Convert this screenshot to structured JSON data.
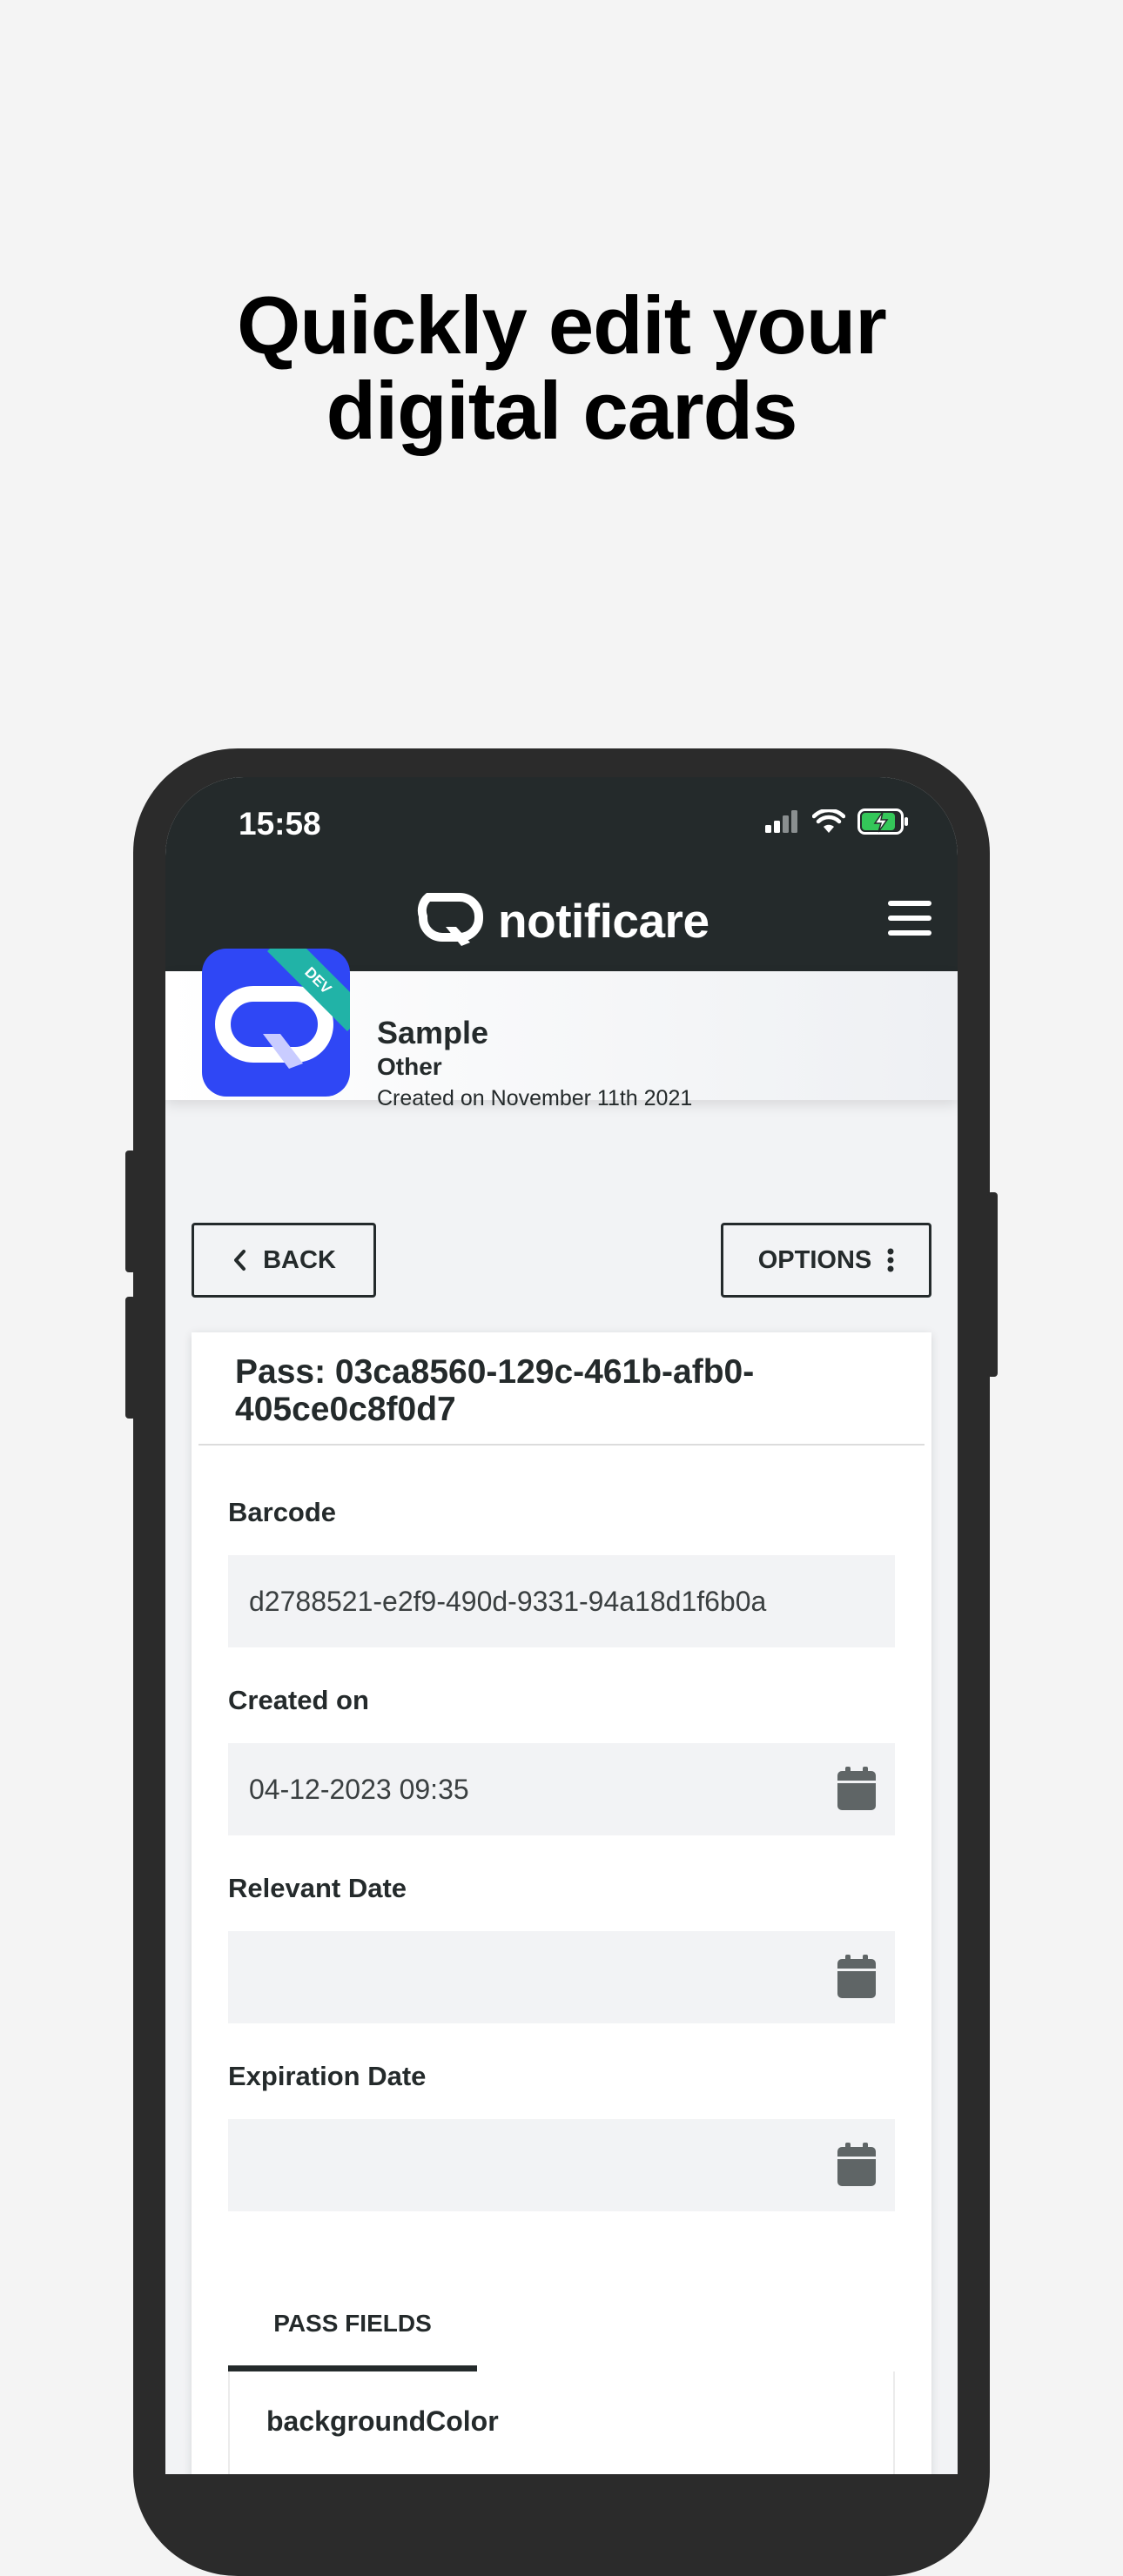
{
  "headline": {
    "line1": "Quickly edit your",
    "line2": "digital cards"
  },
  "status": {
    "time": "15:58"
  },
  "appbar": {
    "brand": "notificare"
  },
  "app": {
    "ribbon": "DEV",
    "name": "Sample",
    "category": "Other",
    "created": "Created on November 11th 2021"
  },
  "actions": {
    "back": "BACK",
    "options": "OPTIONS"
  },
  "pass": {
    "title": "Pass: 03ca8560-129c-461b-afb0-405ce0c8f0d7",
    "fields": [
      {
        "label": "Barcode",
        "value": "d2788521-e2f9-490d-9331-94a18d1f6b0a"
      },
      {
        "label": "Created on",
        "value": "04-12-2023 09:35"
      },
      {
        "label": "Relevant Date",
        "value": ""
      },
      {
        "label": "Expiration Date",
        "value": ""
      }
    ],
    "tab": "PASS FIELDS",
    "pass_field_first": "backgroundColor"
  },
  "colors": {
    "appbar": "#242a2b",
    "app_icon": "#2f47f5",
    "ribbon": "#21b3a7",
    "battery": "#34c759"
  }
}
